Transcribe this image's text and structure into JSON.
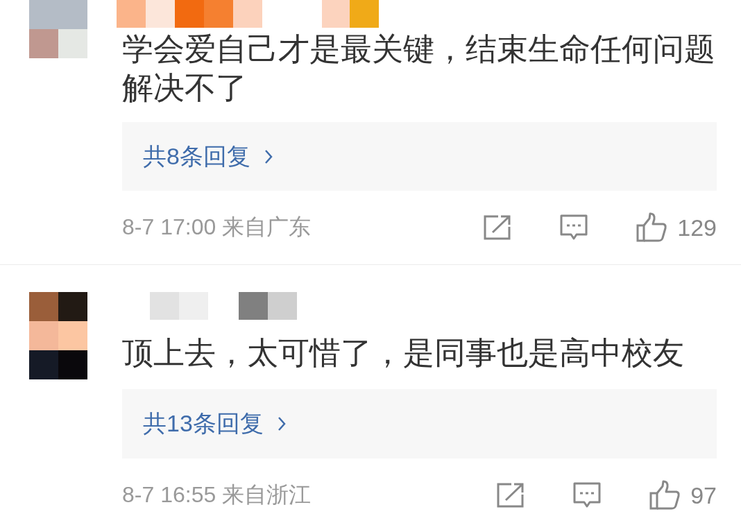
{
  "comments": [
    {
      "text": "学会爱自己才是最关键，结束生命任何问题解决不了",
      "replies": "共8条回复",
      "time": "8-7 17:00",
      "location": "来自广东",
      "likes": "129"
    },
    {
      "text": "顶上去，太可惜了，是同事也是高中校友",
      "replies": "共13条回复",
      "time": "8-7 16:55",
      "location": "来自浙江",
      "likes": "97"
    }
  ]
}
